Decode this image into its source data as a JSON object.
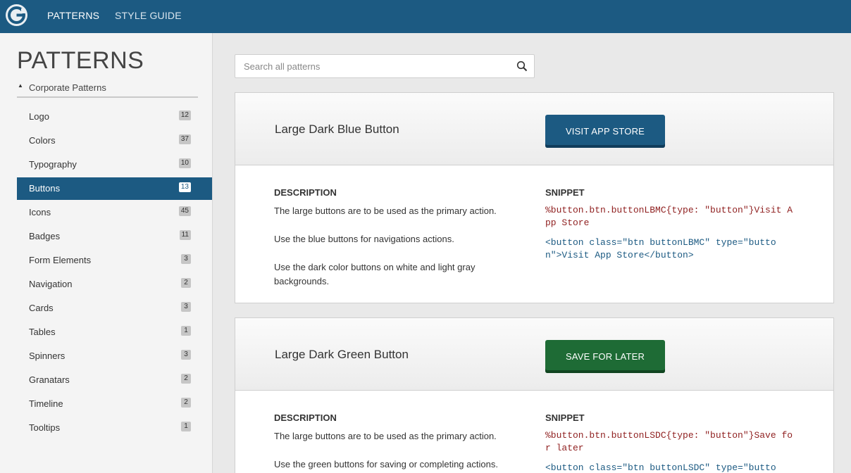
{
  "topbar": {
    "logo_letter": "G",
    "nav": [
      "PATTERNS",
      "STYLE GUIDE"
    ]
  },
  "sidebar": {
    "title": "PATTERNS",
    "group_label": "Corporate Patterns",
    "items": [
      {
        "label": "Logo",
        "count": "12"
      },
      {
        "label": "Colors",
        "count": "37"
      },
      {
        "label": "Typography",
        "count": "10"
      },
      {
        "label": "Buttons",
        "count": "13"
      },
      {
        "label": "Icons",
        "count": "45"
      },
      {
        "label": "Badges",
        "count": "11"
      },
      {
        "label": "Form Elements",
        "count": "3"
      },
      {
        "label": "Navigation",
        "count": "2"
      },
      {
        "label": "Cards",
        "count": "3"
      },
      {
        "label": "Tables",
        "count": "1"
      },
      {
        "label": "Spinners",
        "count": "3"
      },
      {
        "label": "Granatars",
        "count": "2"
      },
      {
        "label": "Timeline",
        "count": "2"
      },
      {
        "label": "Tooltips",
        "count": "1"
      }
    ],
    "active_item": "Buttons"
  },
  "search": {
    "placeholder": "Search all patterns",
    "value": ""
  },
  "cards": [
    {
      "title": "Large Dark Blue Button",
      "button_label": "VISIT APP STORE",
      "button_color": "#1c5a82",
      "description_heading": "DESCRIPTION",
      "description": [
        "The large buttons are to be used as the primary action.",
        "Use the blue buttons for navigations actions.",
        "Use the dark color buttons on white and light gray backgrounds."
      ],
      "snippet_heading": "SNIPPET",
      "snippet_haml": "%button.btn.buttonLBMC{type: \"button\"}Visit A\npp Store",
      "snippet_html": "<button class=\"btn buttonLBMC\" type=\"butto\nn\">Visit App Store</button>"
    },
    {
      "title": "Large Dark Green Button",
      "button_label": "SAVE FOR LATER",
      "button_color": "#1e6b35",
      "description_heading": "DESCRIPTION",
      "description": [
        "The large buttons are to be used as the primary action.",
        "Use the green buttons for saving or completing actions."
      ],
      "snippet_heading": "SNIPPET",
      "snippet_haml": "%button.btn.buttonLSDC{type: \"button\"}Save fo\nr later",
      "snippet_html": "<button class=\"btn buttonLSDC\" type=\"butto"
    }
  ]
}
